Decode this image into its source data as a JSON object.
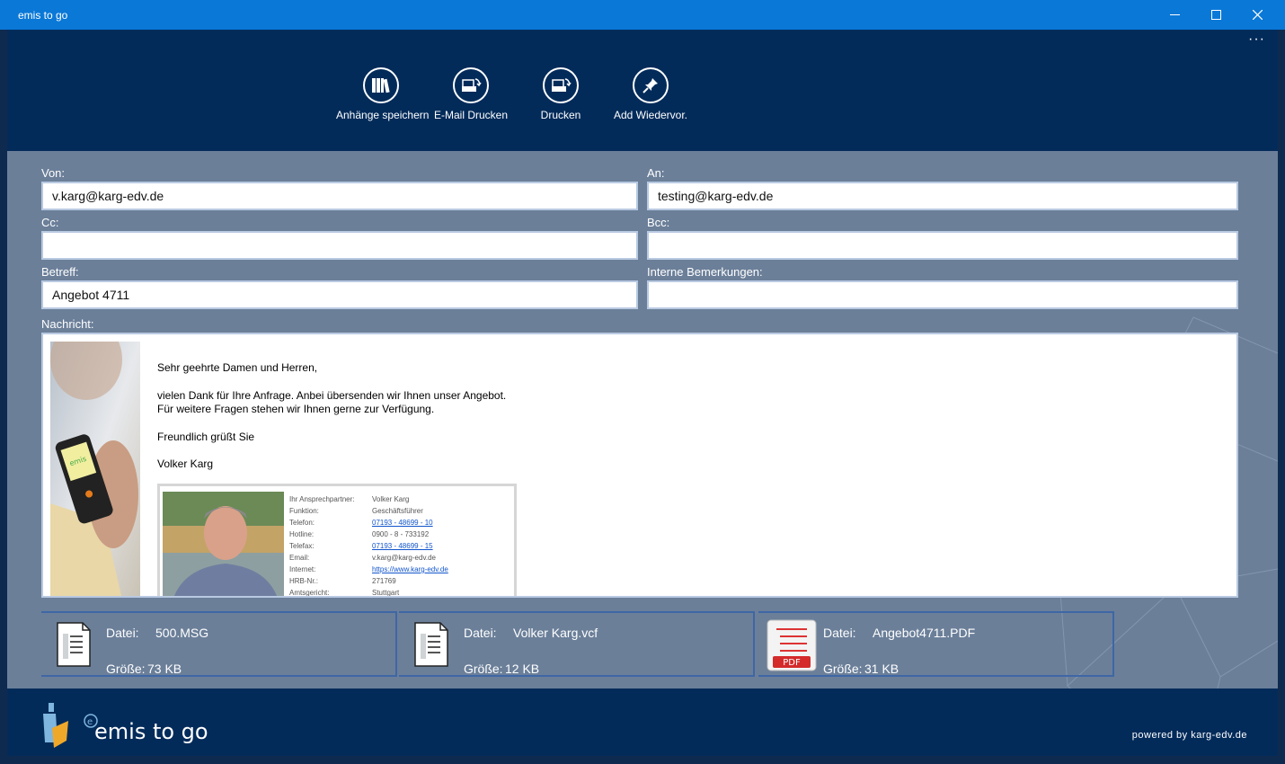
{
  "window": {
    "title": "emis to go",
    "more": "···"
  },
  "toolbar": {
    "items": [
      {
        "label": "Anhänge speichern",
        "icon": "books-icon"
      },
      {
        "label": "E-Mail Drucken",
        "icon": "email-print-icon"
      },
      {
        "label": "Drucken",
        "icon": "print-icon"
      },
      {
        "label": "Add Wiedervor.",
        "icon": "pin-icon"
      }
    ]
  },
  "form": {
    "from_label": "Von:",
    "from_value": "v.karg@karg-edv.de",
    "to_label": "An:",
    "to_value": "testing@karg-edv.de",
    "cc_label": "Cc:",
    "cc_value": "",
    "bcc_label": "Bcc:",
    "bcc_value": "",
    "subject_label": "Betreff:",
    "subject_value": "Angebot 4711",
    "notes_label": "Interne Bemerkungen:",
    "notes_value": "",
    "message_label": "Nachricht:"
  },
  "message": {
    "greeting": "Sehr geehrte Damen und Herren,",
    "line1": "vielen Dank für Ihre Anfrage. Anbei übersenden wir Ihnen unser Angebot.",
    "line2": "Für weitere Fragen stehen wir Ihnen gerne zur Verfügung.",
    "closing": "Freundlich grüßt Sie",
    "name": "Volker Karg",
    "device_label": "emis",
    "signature": [
      {
        "k": "Ihr Ansprechpartner:",
        "v": "Volker Karg",
        "link": false
      },
      {
        "k": "Funktion:",
        "v": "Geschäftsführer",
        "link": false
      },
      {
        "k": "Telefon:",
        "v": "07193 - 48699 - 10",
        "link": true
      },
      {
        "k": "Hotline:",
        "v": "0900 - 8 - 733192",
        "link": false
      },
      {
        "k": "Telefax:",
        "v": "07193 - 48699 - 15",
        "link": true
      },
      {
        "k": "Email:",
        "v": "v.karg@karg-edv.de",
        "link": false
      },
      {
        "k": "Internet:",
        "v": "https://www.karg-edv.de",
        "link": true
      },
      {
        "k": "HRB-Nr.:",
        "v": "271769",
        "link": false
      },
      {
        "k": "Amtsgericht:",
        "v": "Stuttgart",
        "link": false
      }
    ]
  },
  "attachments": [
    {
      "datei_label": "Datei:",
      "name": "500.MSG",
      "groesse_label": "Größe:",
      "size": "73 KB",
      "icon": "msg-file-icon"
    },
    {
      "datei_label": "Datei:",
      "name": "Volker Karg.vcf",
      "groesse_label": "Größe:",
      "size": "12 KB",
      "icon": "vcf-file-icon"
    },
    {
      "datei_label": "Datei:",
      "name": "Angebot4711.PDF",
      "groesse_label": "Größe:",
      "size": "31 KB",
      "icon": "pdf-file-icon",
      "badge": "PDF"
    }
  ],
  "footer": {
    "logo_text": "emis to go",
    "logo_letter": "e",
    "powered": "powered by karg-edv.de"
  },
  "colors": {
    "titlebar": "#0a78d7",
    "header": "#032b5a",
    "body": "#6b7f99",
    "accent": "#3f66a5"
  }
}
